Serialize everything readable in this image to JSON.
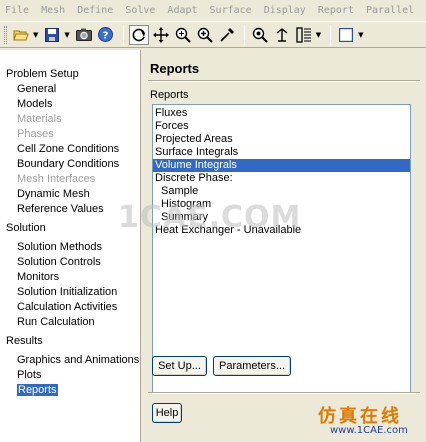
{
  "menu": [
    "File",
    "Mesh",
    "Define",
    "Solve",
    "Adapt",
    "Surface",
    "Display",
    "Report",
    "Parallel"
  ],
  "toolbar_icons": [
    "open-folder-icon",
    "save-icon",
    "camera-icon",
    "help-icon",
    "rotate-icon",
    "pan-icon",
    "zoom-region-icon",
    "zoom-in-icon",
    "probe-icon",
    "zoom-fit-icon",
    "pick-icon",
    "layout-icon",
    "window-icon"
  ],
  "nav": {
    "problem_setup": "Problem Setup",
    "problem_items": [
      "General",
      "Models",
      "Materials",
      "Phases",
      "Cell Zone Conditions",
      "Boundary Conditions",
      "Mesh Interfaces",
      "Dynamic Mesh",
      "Reference Values"
    ],
    "solution": "Solution",
    "solution_items": [
      "Solution Methods",
      "Solution Controls",
      "Monitors",
      "Solution Initialization",
      "Calculation Activities",
      "Run Calculation"
    ],
    "results": "Results",
    "results_items": [
      "Graphics and Animations",
      "Plots",
      "Reports"
    ]
  },
  "panel": {
    "title": "Reports",
    "list_label": "Reports",
    "list_items": [
      "Fluxes",
      "Forces",
      "Projected Areas",
      "Surface Integrals",
      "Volume Integrals",
      "Discrete Phase:",
      "Sample",
      "Histogram",
      "Summary",
      "Heat Exchanger - Unavailable"
    ],
    "setup_label": "Set Up...",
    "parameters_label": "Parameters...",
    "help_label": "Help"
  },
  "watermark": {
    "center": "1CAE.COM",
    "cn": "仿真在线",
    "url": "www.1CAE.com"
  },
  "colors": {
    "selection": "#316ac5",
    "background": "#ece9d8"
  }
}
